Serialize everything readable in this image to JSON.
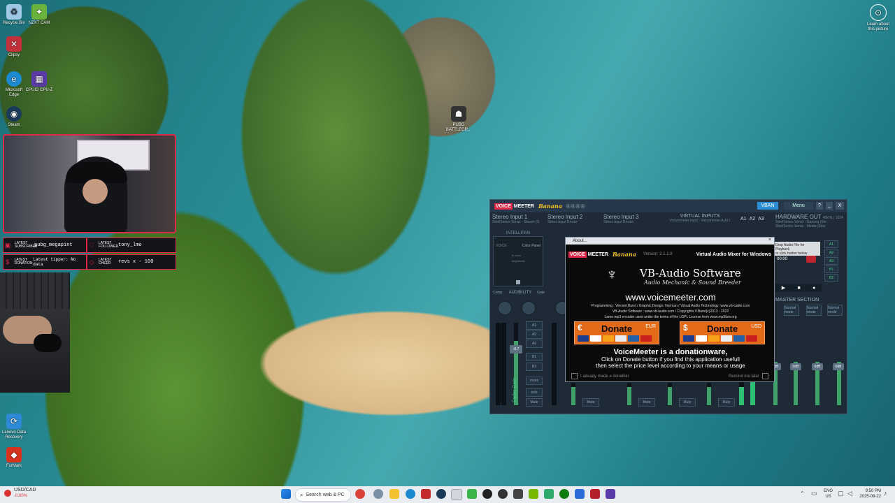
{
  "desktop": {
    "icons": [
      {
        "label": "Recycle Bin",
        "icon": "recycle-bin-icon"
      },
      {
        "label": "NZXT CAM",
        "icon": "nzxt-icon"
      },
      {
        "label": "Clipsy",
        "icon": "clipsy-icon"
      },
      {
        "label": "Microsoft Edge",
        "icon": "edge-icon"
      },
      {
        "label": "CPUID CPU-Z",
        "icon": "cpuz-icon"
      },
      {
        "label": "Steam",
        "icon": "steam-icon"
      },
      {
        "label": "PUBG BATTLEGR...",
        "icon": "pubg-icon"
      },
      {
        "label": "Lenovo Data Recovery",
        "icon": "lenovo-icon"
      },
      {
        "label": "FurMark",
        "icon": "furmark-icon"
      },
      {
        "label": "Learn about this picture",
        "icon": "camera-icon"
      }
    ]
  },
  "overlay": {
    "latest_subscriber_label": "LATEST SUBSCRIBER",
    "latest_subscriber_value": "pubg_megapint",
    "latest_follower_label": "LATEST FOLLOWER",
    "latest_follower_value": "tony_lmo",
    "latest_donation_label": "LATEST DONATION",
    "latest_donation_value": "Latest tipper: No data",
    "latest_cheer_label": "LATEST CHEER",
    "latest_cheer_value": "revs x - 100"
  },
  "voicemeeter": {
    "logo_voice": "VOICE",
    "logo_meeter": "MEETER",
    "logo_banana": "Banana",
    "vban": "VBAN",
    "menu": "Menu",
    "help": "?",
    "minimize": "_",
    "close": "X",
    "strips": [
      {
        "name": "Stereo Input 1",
        "device": "SteelSeries Sonar - Stream (S"
      },
      {
        "name": "Stereo Input 2",
        "device": "Select Input Device"
      },
      {
        "name": "Stereo Input 3",
        "device": "Select Input Device"
      }
    ],
    "virtual_inputs_label": "VIRTUAL INPUTS",
    "virtual_input_1": "Voicemeeter Input",
    "virtual_input_2": "Voicemeeter AUX I",
    "hw_out_label": "HARDWARE OUT",
    "hw_out_rate": "48kHz | 1024",
    "hw_out_dev1": "SteelSeries Sonar - Gaming (Ste",
    "hw_out_dev2": "SteelSeries Sonar - Media (Stee",
    "bus_a": [
      "A1",
      "A2",
      "A3"
    ],
    "intellipan": "INTELLIPAN",
    "voice": "VOICE",
    "color_panel": "Color Panel",
    "fx_echo": "fx echo",
    "brightness": "brightness",
    "audibility": "AUDIBILITY",
    "comp": "Comp.",
    "gate": "Gate",
    "fader_gain": "Fader Gain",
    "fader_value": "-8.7",
    "route_buttons": [
      "A1",
      "A2",
      "A3",
      "B1",
      "B2"
    ],
    "mono": "mono",
    "solo": "solo",
    "mute": "Mute",
    "master_section": "MASTER SECTION",
    "normal_mode": "Normal mode",
    "out_value": "0dB",
    "playback_label": "Drop Audio File for Playback",
    "playback_sub": "or click button below",
    "playback_time": "00:00",
    "master_buses": [
      "A1",
      "A2",
      "A3",
      "B1",
      "B2"
    ]
  },
  "about": {
    "title": "About...",
    "version": "Version: 2.1.1.9",
    "tagline": "Virtual Audio Mixer for Windows",
    "company": "VB-Audio Software",
    "company_sub": "Audio Mechanic & Sound Breeder",
    "url": "www.voicemeeter.com",
    "credits_1": "Programming : Vincent Burel / Graphic Design: Norman / Virtual Audio Technology: www.vb-cable.com",
    "credits_2": "VB-Audio Software : www.vb-audio.com / Copyrights V.Burel(c)2013 - 2022",
    "credits_3": "Lame mp3 encoder used under the terms of the LGPL License from www.mp3dev.org",
    "donate_eur_symbol": "€",
    "donate_eur_label": "Donate",
    "donate_eur_code": "EUR",
    "donate_usd_symbol": "$",
    "donate_usd_label": "Donate",
    "donate_usd_code": "USD",
    "donationware": "VoiceMeeter is a donationware,",
    "donation_line_1": "Click on Donate button if you find this application usefull",
    "donation_line_2": "then select the price level according to your means or usage",
    "already_donated": "I already made a donation",
    "remind_later": "Remind me later"
  },
  "taskbar": {
    "ticker_pair": "USD/CAD",
    "ticker_change": "-0.60%",
    "search_placeholder": "Search web & PC",
    "lang_1": "ENG",
    "lang_2": "US",
    "time": "9:50 PM",
    "date": "2025-08-22"
  },
  "colors": {
    "accent_red": "#e0294a",
    "vm_bg": "#1e2b36",
    "donate_orange": "#e26a19",
    "fader_green": "#3fa06a",
    "vban_blue": "#2b8fd6"
  }
}
